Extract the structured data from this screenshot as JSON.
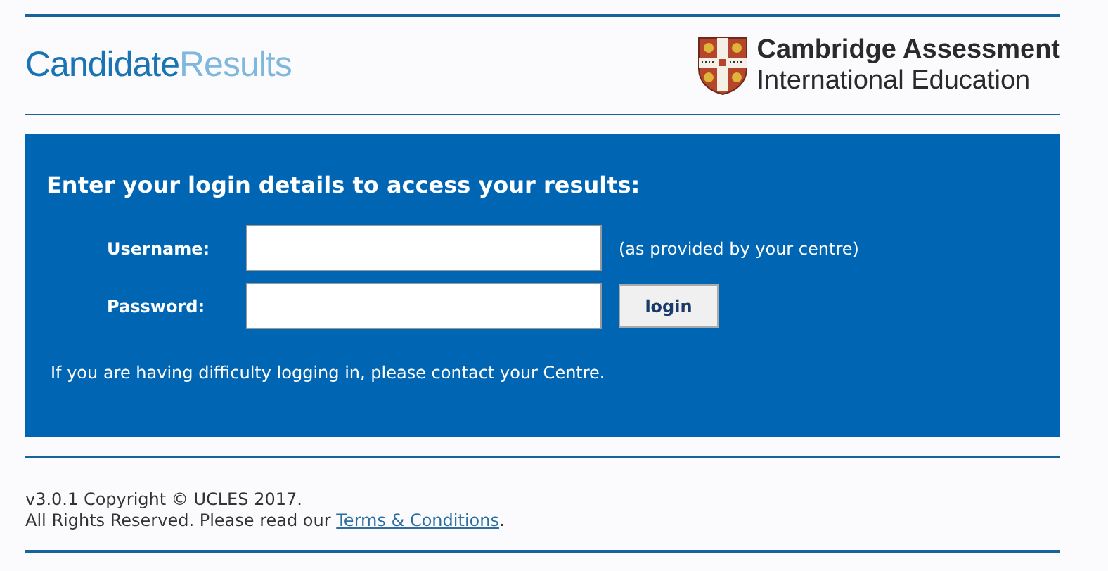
{
  "header": {
    "logo": {
      "part1": "Candidate",
      "part2": "Results"
    },
    "brand": {
      "line1": "Cambridge Assessment",
      "line2": "International Education"
    }
  },
  "login": {
    "heading": "Enter your login details to access your results:",
    "fields": [
      {
        "label": "Username:",
        "note": "(as provided by your centre)"
      },
      {
        "label": "Password:",
        "button": "login"
      }
    ],
    "help": "If you are having difficulty logging in, please contact your Centre."
  },
  "footer": {
    "line1": "v3.0.1 Copyright © UCLES 2017.",
    "line2": "All Rights Reserved. Please read our",
    "link": "Terms & Conditions",
    "after": "."
  }
}
